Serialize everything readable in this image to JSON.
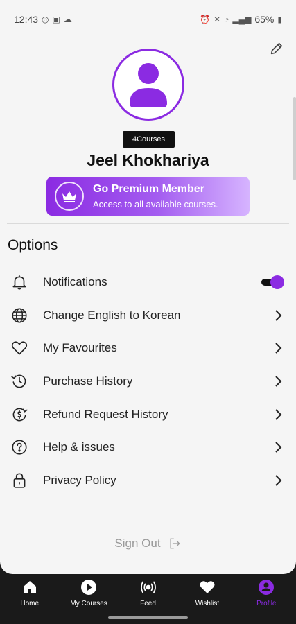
{
  "status_bar": {
    "time": "12:43",
    "battery": "65%"
  },
  "profile": {
    "courses_badge": "4Courses",
    "name": "Jeel Khokhariya"
  },
  "premium": {
    "title": "Go Premium Member",
    "subtitle": "Access to all available courses."
  },
  "options": {
    "title": "Options",
    "items": [
      {
        "label": "Notifications",
        "icon": "bell-icon",
        "control": "toggle",
        "toggle_on": true
      },
      {
        "label": "Change English to Korean",
        "icon": "globe-icon",
        "control": "chevron"
      },
      {
        "label": "My Favourites",
        "icon": "heart-outline-icon",
        "control": "chevron"
      },
      {
        "label": "Purchase History",
        "icon": "history-icon",
        "control": "chevron"
      },
      {
        "label": "Refund Request History",
        "icon": "refund-icon",
        "control": "chevron"
      },
      {
        "label": "Help & issues",
        "icon": "help-icon",
        "control": "chevron"
      },
      {
        "label": "Privacy Policy",
        "icon": "lock-icon",
        "control": "chevron"
      }
    ]
  },
  "signout": {
    "label": "Sign Out"
  },
  "nav": {
    "items": [
      {
        "label": "Home",
        "icon": "home-icon",
        "active": false
      },
      {
        "label": "My Courses",
        "icon": "play-circle-icon",
        "active": false
      },
      {
        "label": "Feed",
        "icon": "broadcast-icon",
        "active": false
      },
      {
        "label": "Wishlist",
        "icon": "heart-icon",
        "active": false
      },
      {
        "label": "Profile",
        "icon": "profile-icon",
        "active": true
      }
    ]
  },
  "colors": {
    "accent": "#8b2be2",
    "nav_bg": "#1a1a1a",
    "screen_bg": "#f5f5f5"
  }
}
